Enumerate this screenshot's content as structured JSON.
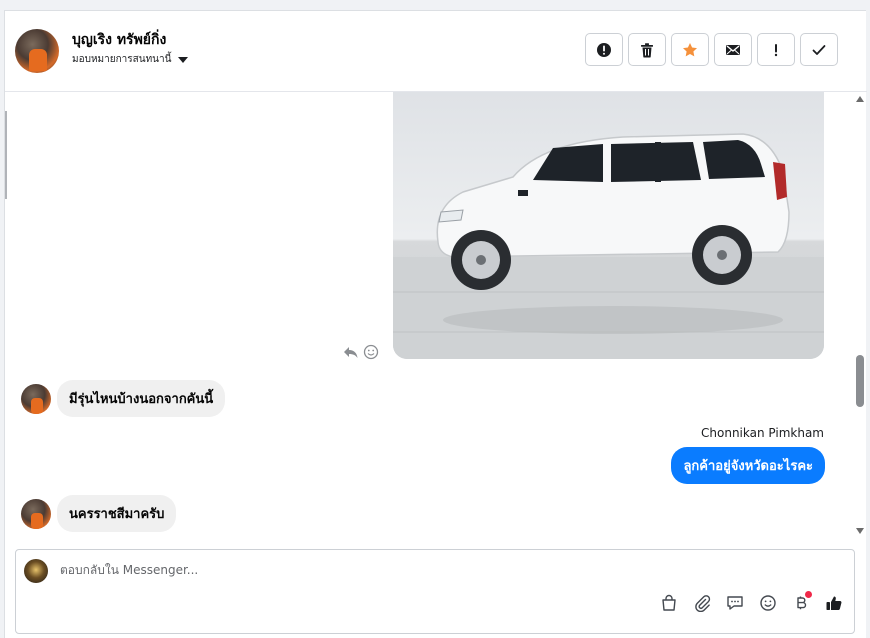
{
  "header": {
    "contact_name": "บุญเริง ทรัพย์กิ่ง",
    "assign_label": "มอบหมายการสนทนานี้",
    "actions": [
      {
        "icon": "alert-circle-icon",
        "name": "mark-spam-button"
      },
      {
        "icon": "trash-icon",
        "name": "delete-button"
      },
      {
        "icon": "star-icon",
        "name": "star-button"
      },
      {
        "icon": "envelope-icon",
        "name": "mark-unread-button"
      },
      {
        "icon": "exclamation-icon",
        "name": "follow-up-button"
      },
      {
        "icon": "check-icon",
        "name": "mark-done-button"
      }
    ],
    "star_color": "#f5913b"
  },
  "thread": {
    "messages": [
      {
        "direction": "in",
        "text": "มีรุ่นไหนบ้างนอกจากคันนี้"
      },
      {
        "direction": "out",
        "sender": "Chonnikan Pimkham",
        "text": "ลูกค้าอยู่จังหวัดอะไรคะ"
      },
      {
        "direction": "in",
        "text": "นครราชสีมาครับ"
      }
    ],
    "outgoing_color": "#0a7cff"
  },
  "composer": {
    "placeholder": "ตอบกลับใน Messenger..."
  }
}
